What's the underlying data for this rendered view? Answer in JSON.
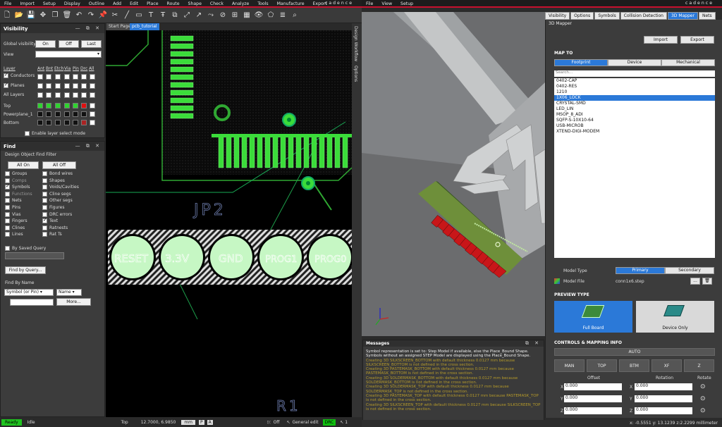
{
  "left_menu": [
    "File",
    "Import",
    "Setup",
    "Display",
    "Outline",
    "Add",
    "Edit",
    "Place",
    "Route",
    "Shape",
    "Check",
    "Analyze",
    "Tools",
    "Manufacture",
    "Export"
  ],
  "right_menu": [
    "File",
    "View",
    "Setup"
  ],
  "brand": "cadence",
  "visibility": {
    "title": "Visibility",
    "global_label": "Global visibility",
    "on": "On",
    "off": "Off",
    "last": "Last",
    "view_label": "View",
    "cols": [
      "Layer",
      "Ant",
      "Bnt",
      "Etch",
      "Via",
      "Pin",
      "Drc",
      "All"
    ],
    "rows": [
      "Conductors",
      "Planes",
      "All Layers",
      "Top",
      "Powerplane_1",
      "Bottom"
    ],
    "enable": "Enable layer select mode"
  },
  "find": {
    "title": "Find",
    "filter_title": "Design Object Find Filter",
    "all_on": "All On",
    "all_off": "All Off",
    "left_items": [
      "Groups",
      "Comps",
      "Symbols",
      "Functions",
      "Nets",
      "Pins",
      "Vias",
      "Fingers",
      "Clines",
      "Lines"
    ],
    "right_items": [
      "Bond wires",
      "Shapes",
      "Voids/Cavities",
      "Cline segs",
      "Other segs",
      "Figures",
      "DRC errors",
      "Text",
      "Ratnests",
      "Rat Ts"
    ],
    "saved_query": "By Saved Query",
    "find_by_query": "Find by Query...",
    "find_by_name": "Find By Name",
    "sel1": "Symbol (or Pin)",
    "sel2": "Name",
    "more": "More..."
  },
  "tabs": {
    "start": "Start Page",
    "pcb": "pcb_tutorial"
  },
  "side_tabs": [
    "Design Workflow",
    "Options"
  ],
  "board": {
    "jp2": "JP2",
    "r1": "R1",
    "pads": [
      "RESET",
      "3.3V",
      "GND",
      "PROG1",
      "PROG0"
    ]
  },
  "status": {
    "ready": "Ready",
    "idle": "Idle",
    "layer": "Top",
    "coords": "12.7000, 6.9850",
    "unit": "mm",
    "p": "P",
    "a": "A",
    "off": "Off",
    "mode": "General edit",
    "drc": "DRC",
    "count": "1"
  },
  "right_tabs": [
    "Visibility",
    "Options",
    "Symbols",
    "Collision Detection",
    "3D Mapper",
    "Nets"
  ],
  "mapper": {
    "title": "3D Mapper",
    "import": "Import",
    "export": "Export",
    "map_to": "MAP TO",
    "map_tabs": [
      "Footprint",
      "Device",
      "Mechanical"
    ],
    "search": "Search...",
    "list": [
      "0402-CAP",
      "0402-RES",
      "1210",
      "1X06_LOCK",
      "CRYSTAL-SMD",
      "LED_LIN",
      "MSOP_8_ADI",
      "SQFP-S-10X10-64",
      "USB-MICROB",
      "XTEND-DIGI-MODEM"
    ],
    "selected": "1X06_LOCK",
    "model_type": "Model Type",
    "primary": "Primary",
    "secondary": "Secondary",
    "model_file": "Model File",
    "file_value": "conn1x6.step",
    "dots": "...",
    "preview": "PREVIEW TYPE",
    "full_board": "Full Board",
    "device_only": "Device Only",
    "controls": "CONTROLS & MAPPING INFO",
    "auto": "AUTO",
    "ctrl_btns": [
      "MAN",
      "TOP",
      "BTM",
      "XF",
      "Z"
    ],
    "offset": "Offset",
    "rotation": "Rotation",
    "rotate": "Rotate",
    "axes": [
      "X",
      "Y",
      "Z"
    ],
    "val": "0.000"
  },
  "messages": {
    "title": "Messages",
    "lines": [
      "Symbol representation is set to: Step Model if available, else the Place_Bound Shape.",
      "Symbols without an assigned STEP Model are displayed using the Place_Bound Shape.",
      "Creating 3D SILKSCREEN_BOTTOM with default thickness 0.0127 mm because",
      "SILKSCREEN_BOTTOM is not defined in the cross section.",
      "Creating 3D PASTEMASK_BOTTOM with default thickness 0.0127 mm because",
      "PASTEMASK_BOTTOM is not defined in the cross section.",
      "Creating 3D SOLDERMASK_BOTTOM with default thickness 0.0127 mm because",
      "SOLDERMASK_BOTTOM is not defined in the cross section.",
      "Creating 3D SOLDERMASK_TOP with default thickness 0.0127 mm because",
      "SOLDERMASK_TOP is not defined in the cross section.",
      "Creating 3D PASTEMASK_TOP with default thickness 0.0127 mm because PASTEMASK_TOP",
      "is not defined in the cross section.",
      "Creating 3D SILKSCREEN_TOP with default thickness 0.0127 mm because SILKSCREEN_TOP",
      "is not defined in the cross section."
    ]
  },
  "coord_readout": "x: -0.5551 y: 13.1239 z:2.2299 millimeter",
  "colors": {
    "accent": "#2b79d8",
    "copper": "#39d93a",
    "drc": "#0fbf0f"
  }
}
